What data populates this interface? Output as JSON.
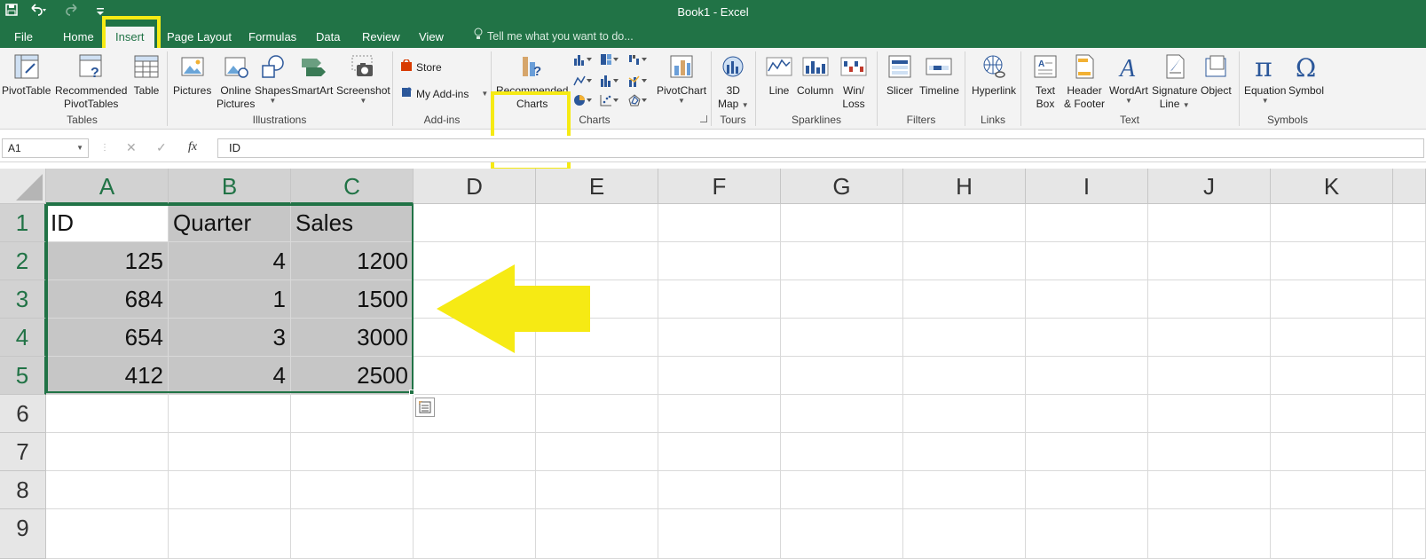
{
  "window": {
    "title": "Book1 - Excel",
    "qat": {
      "save_icon": "save-icon",
      "undo_icon": "undo-icon",
      "redo_icon": "redo-icon",
      "customize_icon": "customize-qat-icon"
    }
  },
  "tabs": [
    {
      "label": "File"
    },
    {
      "label": "Home"
    },
    {
      "label": "Insert",
      "active": true
    },
    {
      "label": "Page Layout"
    },
    {
      "label": "Formulas"
    },
    {
      "label": "Data"
    },
    {
      "label": "Review"
    },
    {
      "label": "View"
    }
  ],
  "tell_me": {
    "placeholder": "Tell me what you want to do..."
  },
  "ribbon": {
    "tables": {
      "group": "Tables",
      "pivottable": "PivotTable",
      "rec_pivot_1": "Recommended",
      "rec_pivot_2": "PivotTables",
      "table": "Table"
    },
    "illustrations": {
      "group": "Illustrations",
      "pictures": "Pictures",
      "online_1": "Online",
      "online_2": "Pictures",
      "shapes": "Shapes",
      "smartart": "SmartArt",
      "screenshot": "Screenshot"
    },
    "addins": {
      "group": "Add-ins",
      "store": "Store",
      "my_addins": "My Add-ins"
    },
    "charts": {
      "group": "Charts",
      "rec_1": "Recommended",
      "rec_2": "Charts",
      "pivotchart": "PivotChart"
    },
    "tours": {
      "group": "Tours",
      "map_1": "3D",
      "map_2": "Map"
    },
    "sparklines": {
      "group": "Sparklines",
      "line": "Line",
      "column": "Column",
      "winloss_1": "Win/",
      "winloss_2": "Loss"
    },
    "filters": {
      "group": "Filters",
      "slicer": "Slicer",
      "timeline": "Timeline"
    },
    "links": {
      "group": "Links",
      "hyperlink": "Hyperlink"
    },
    "text": {
      "group": "Text",
      "textbox_1": "Text",
      "textbox_2": "Box",
      "header_1": "Header",
      "header_2": "& Footer",
      "wordart": "WordArt",
      "signature_1": "Signature",
      "signature_2": "Line",
      "object": "Object"
    },
    "symbols": {
      "group": "Symbols",
      "equation": "Equation",
      "symbol": "Symbol"
    }
  },
  "formula_bar": {
    "name_box": "A1",
    "cancel": "✕",
    "enter": "✓",
    "fx": "fx",
    "content": "ID"
  },
  "sheet": {
    "columns": [
      "A",
      "B",
      "C",
      "D",
      "E",
      "F",
      "G",
      "H",
      "I",
      "J",
      "K"
    ],
    "rows": [
      "1",
      "2",
      "3",
      "4",
      "5",
      "6",
      "7",
      "8",
      "9"
    ],
    "data": [
      [
        "ID",
        "Quarter",
        "Sales"
      ],
      [
        "125",
        "4",
        "1200"
      ],
      [
        "684",
        "1",
        "1500"
      ],
      [
        "654",
        "3",
        "3000"
      ],
      [
        "412",
        "4",
        "2500"
      ]
    ]
  },
  "colors": {
    "excel_green": "#217346",
    "highlight": "#f6ea14",
    "arrow": "#f6ea14"
  }
}
